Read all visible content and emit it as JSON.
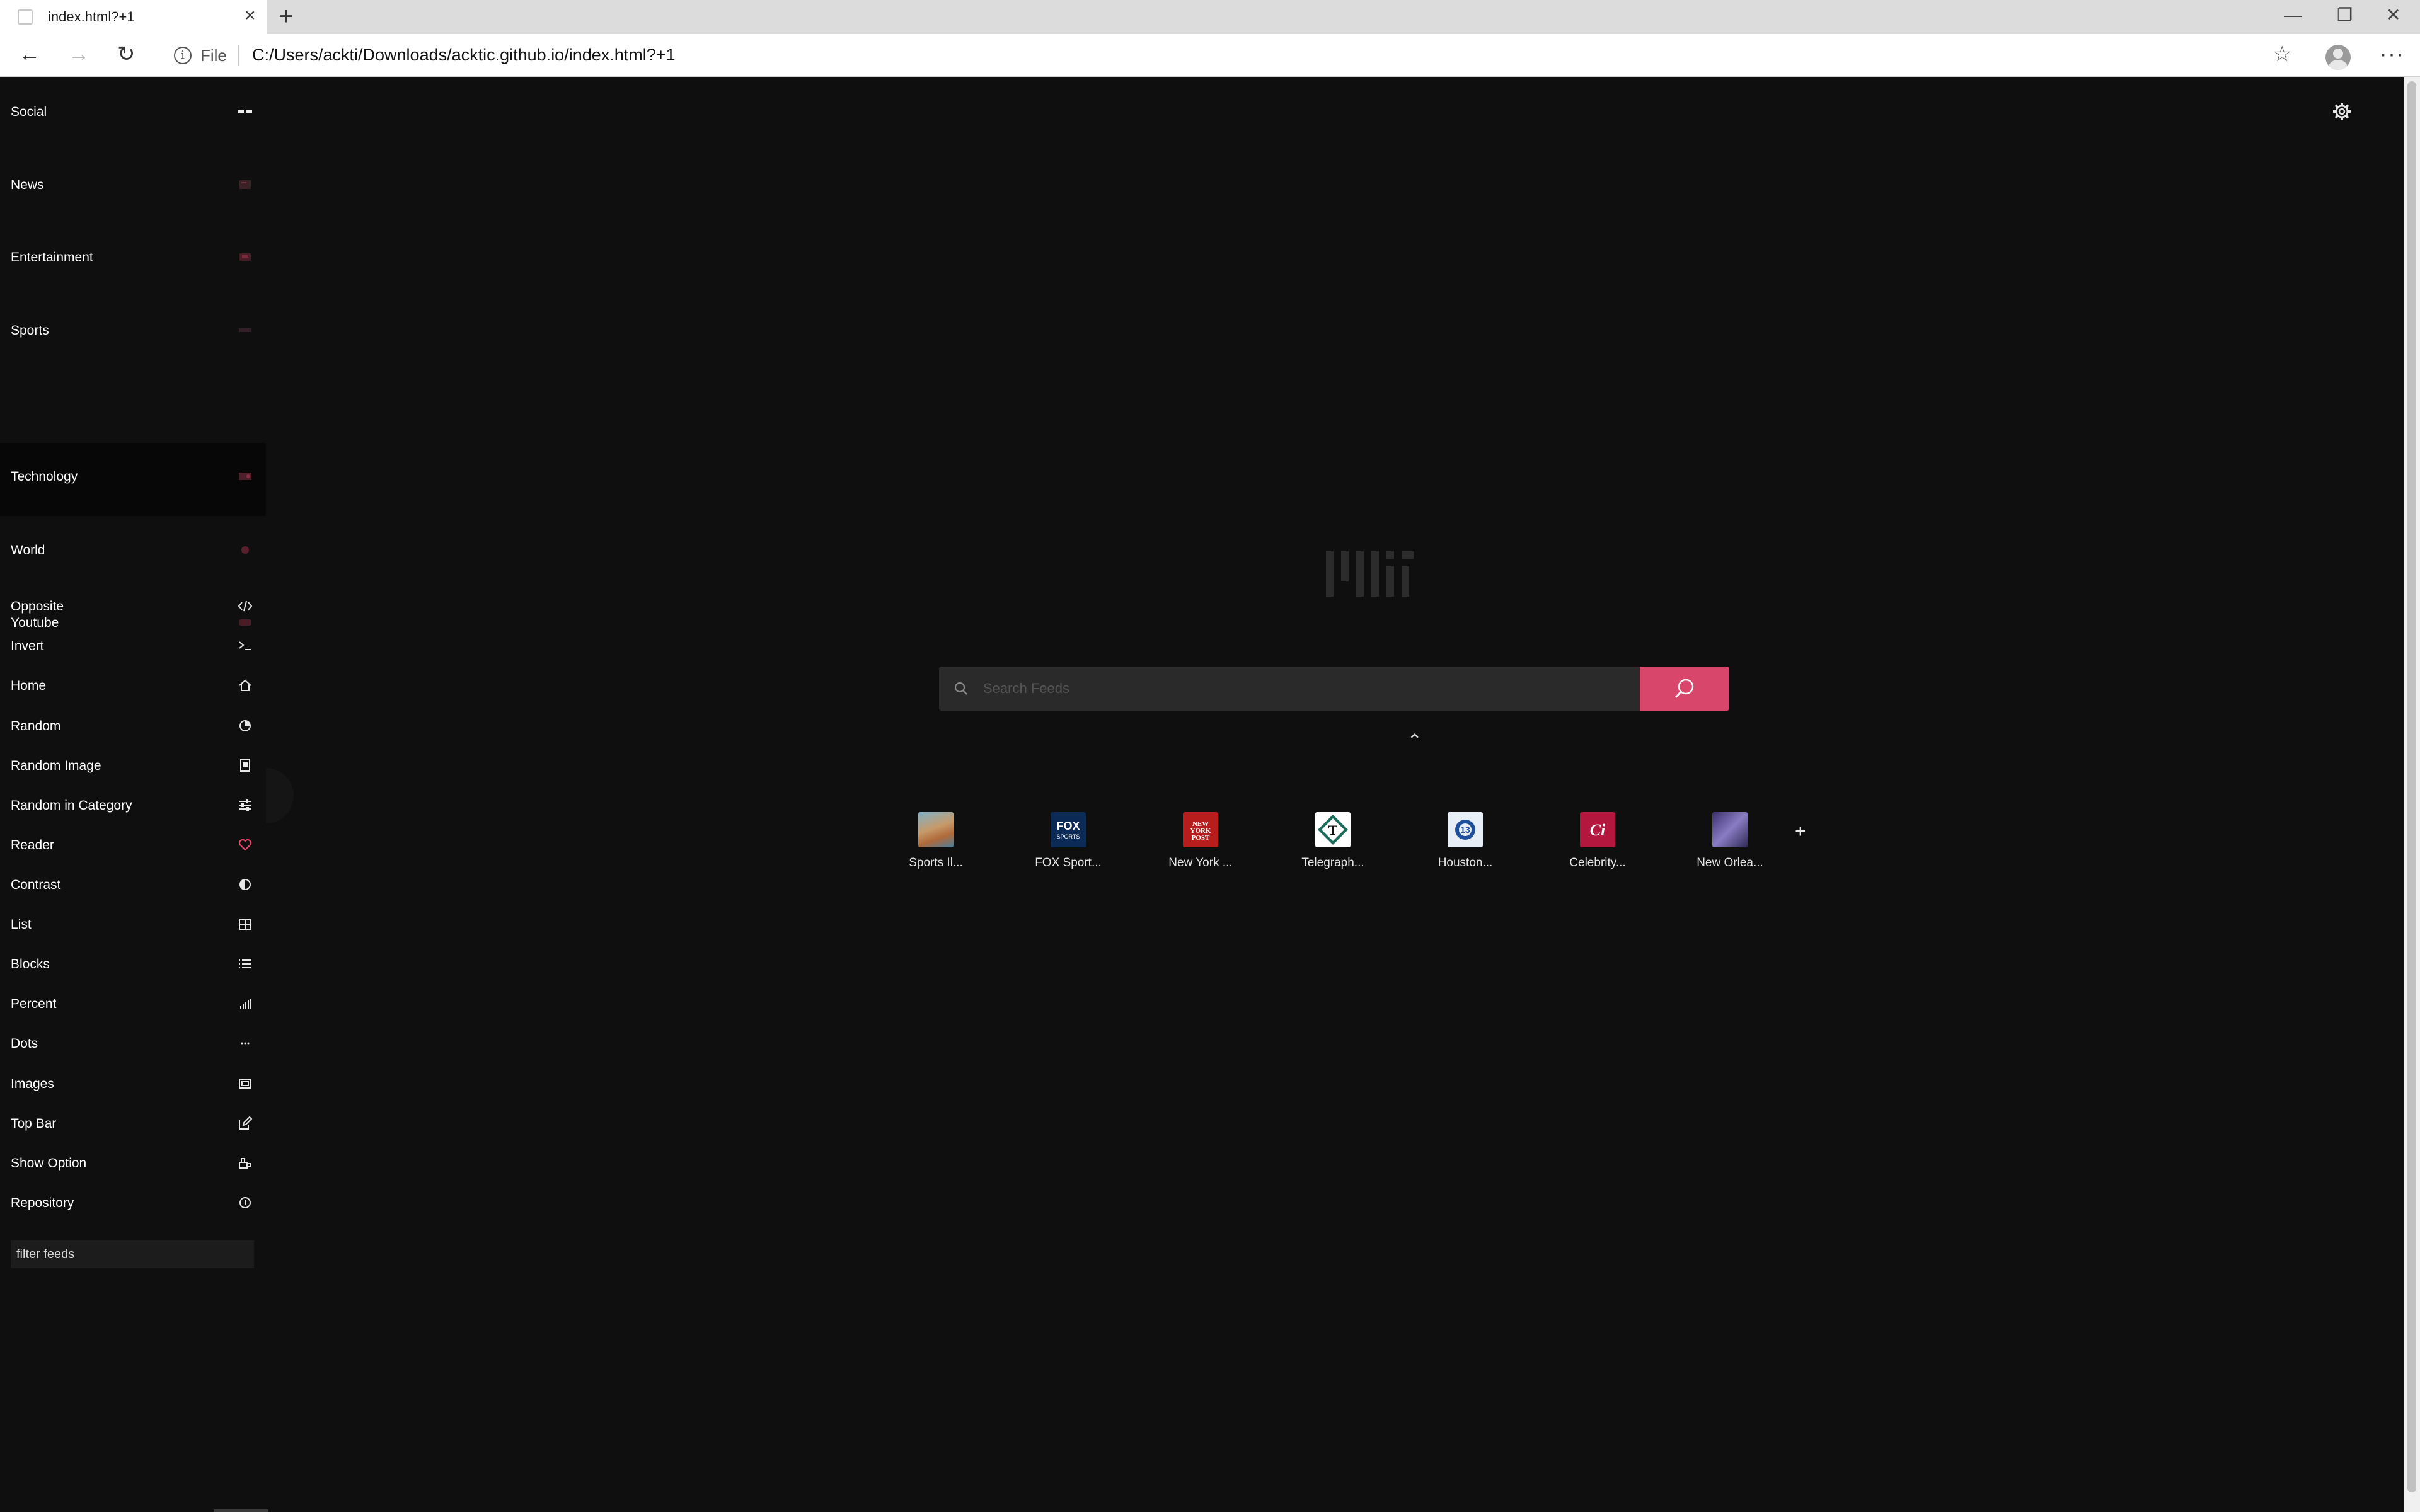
{
  "browser": {
    "tab_title": "index.html?+1",
    "address_scheme": "File",
    "address_url": "C:/Users/ackti/Downloads/acktic.github.io/index.html?+1"
  },
  "sidebar": {
    "categories": [
      {
        "label": "Social",
        "icon": "social-icon"
      },
      {
        "label": "News",
        "icon": "news-icon"
      },
      {
        "label": "Entertainment",
        "icon": "entertainment-icon"
      },
      {
        "label": "Sports",
        "icon": "sports-icon"
      },
      {
        "label": "Technology",
        "icon": "technology-icon"
      },
      {
        "label": "World",
        "icon": "world-icon"
      },
      {
        "label": "Youtube",
        "icon": "youtube-icon"
      }
    ],
    "options": [
      {
        "label": "Opposite",
        "icon": "code-icon"
      },
      {
        "label": "Invert",
        "icon": "terminal-icon"
      },
      {
        "label": "Home",
        "icon": "home-icon"
      },
      {
        "label": "Random",
        "icon": "pie-icon"
      },
      {
        "label": "Random Image",
        "icon": "image-frame-icon"
      },
      {
        "label": "Random in Category",
        "icon": "sliders-icon"
      },
      {
        "label": "Reader",
        "icon": "heart-icon"
      },
      {
        "label": "Contrast",
        "icon": "contrast-icon"
      },
      {
        "label": "List",
        "icon": "grid-icon"
      },
      {
        "label": "Blocks",
        "icon": "list-icon"
      },
      {
        "label": "Percent",
        "icon": "signal-icon"
      },
      {
        "label": "Dots",
        "icon": "dots-icon"
      },
      {
        "label": "Images",
        "icon": "images-icon"
      },
      {
        "label": "Top Bar",
        "icon": "edit-icon"
      },
      {
        "label": "Show Option",
        "icon": "option-icon"
      },
      {
        "label": "Repository",
        "icon": "info-icon"
      }
    ],
    "filter_placeholder": "filter feeds"
  },
  "main": {
    "search_placeholder": "Search Feeds",
    "feeds": [
      {
        "label": "Sports Il..."
      },
      {
        "label": "FOX Sport..."
      },
      {
        "label": "New York ..."
      },
      {
        "label": "Telegraph..."
      },
      {
        "label": "Houston..."
      },
      {
        "label": "Celebrity..."
      },
      {
        "label": "New Orlea..."
      }
    ]
  },
  "colors": {
    "background": "#0f0f0f",
    "accent": "#d9466b",
    "reader_heart": "#e6476a"
  }
}
